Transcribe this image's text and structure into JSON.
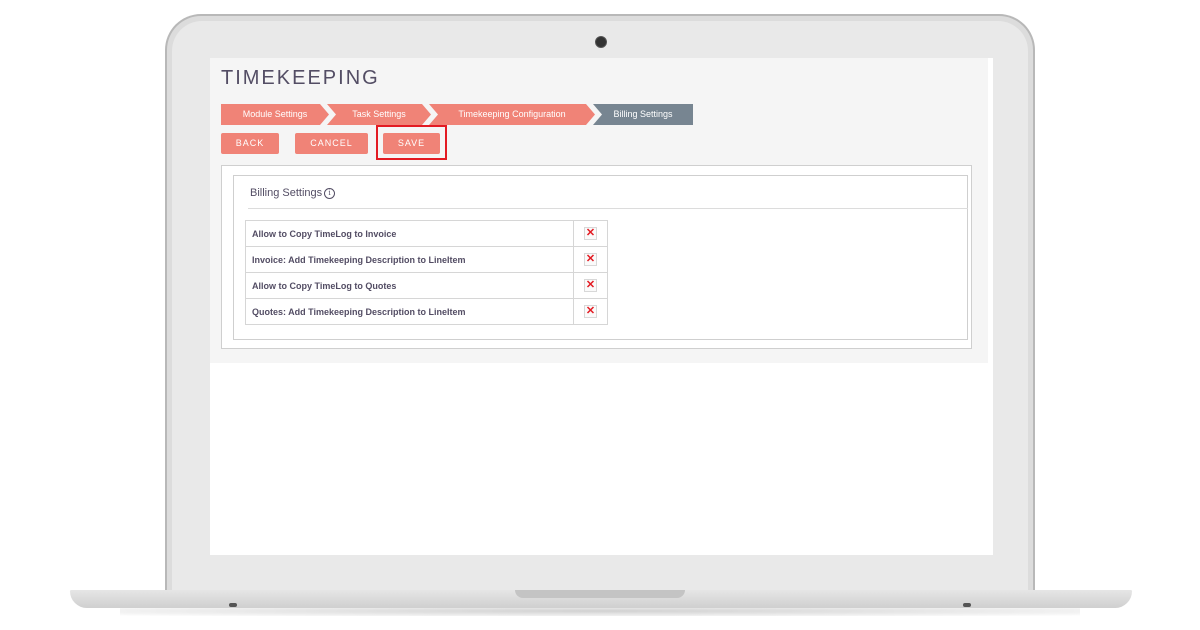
{
  "app": {
    "title": "TIMEKEEPING"
  },
  "wizard": {
    "steps": [
      {
        "label": "Module Settings"
      },
      {
        "label": "Task Settings"
      },
      {
        "label": "Timekeeping Configuration"
      },
      {
        "label": "Billing Settings"
      }
    ]
  },
  "actions": {
    "back_label": "BACK",
    "cancel_label": "CANCEL",
    "save_label": "SAVE"
  },
  "panel": {
    "title": "Billing Settings",
    "info_glyph": "i"
  },
  "settings": [
    {
      "label": "Allow to Copy TimeLog to Invoice",
      "icon": "x-icon",
      "value_glyph": "✕"
    },
    {
      "label": "Invoice: Add Timekeeping Description to LineItem",
      "icon": "x-icon",
      "value_glyph": "✕"
    },
    {
      "label": "Allow to Copy TimeLog to Quotes",
      "icon": "x-icon",
      "value_glyph": "✕"
    },
    {
      "label": "Quotes: Add Timekeeping Description to LineItem",
      "icon": "x-icon",
      "value_glyph": "✕"
    }
  ],
  "colors": {
    "accent": "#f08377",
    "active_step": "#778591",
    "highlight": "#e31b23",
    "text": "#534d64"
  }
}
